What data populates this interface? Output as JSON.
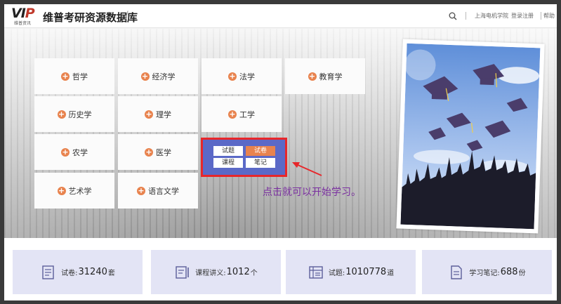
{
  "header": {
    "logo_text": "VIP",
    "logo_sub": "维普资讯",
    "site_title": "维普考研资源数据库",
    "slash": "/",
    "institution": "上海电机学院",
    "login_register": "登录注册",
    "help": "帮助"
  },
  "subjects": [
    {
      "label": "哲学"
    },
    {
      "label": "经济学"
    },
    {
      "label": "法学"
    },
    {
      "label": "教育学"
    },
    {
      "label": "历史学"
    },
    {
      "label": "理学"
    },
    {
      "label": "工学"
    },
    {
      "label": "农学"
    },
    {
      "label": "医学"
    },
    {
      "label": "艺术学"
    },
    {
      "label": "语言文学"
    }
  ],
  "popup": {
    "items": [
      "试题",
      "试卷",
      "课程",
      "笔记"
    ],
    "active": "试卷"
  },
  "hint_text": "点击就可以开始学习。",
  "stats": [
    {
      "label": "试卷:",
      "value": "31240",
      "unit": "套",
      "icon": "paper-icon"
    },
    {
      "label": "课程讲义:",
      "value": "1012",
      "unit": "个",
      "icon": "lecture-icon"
    },
    {
      "label": "试题:",
      "value": "1010778",
      "unit": "道",
      "icon": "question-icon"
    },
    {
      "label": "学习笔记:",
      "value": "688",
      "unit": "份",
      "icon": "notes-icon"
    }
  ],
  "colors": {
    "accent": "#e8834e",
    "popup_bg": "#5b69c7",
    "highlight_border": "#e8262a",
    "hint_text": "#7a2fa0",
    "stat_card": "#e3e4f5"
  }
}
